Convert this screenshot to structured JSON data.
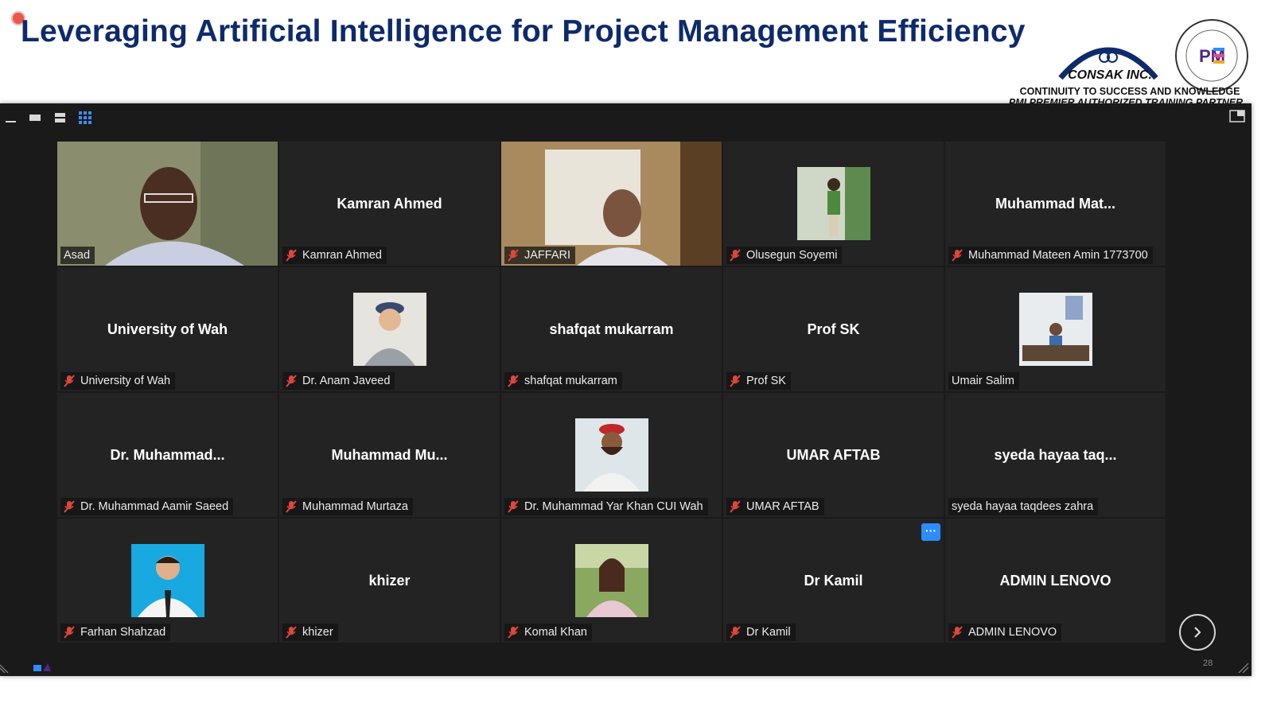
{
  "slide": {
    "title": "Leveraging Artificial Intelligence for Project Management Efficiency",
    "brand_name": "CONSAK INC.",
    "tagline": "CONTINUITY TO SUCCESS AND KNOWLEDGE",
    "tagline2": "PMI PREMIER AUTHORIZED TRAINING PARTNER",
    "pmi_seal_text": "PROJECT MANAGEMENT INSTITUTE · AUTHORIZED TRAINING PARTNER",
    "page_number": "28",
    "colors": {
      "title": "#0d2a6b",
      "accent": "#2d8cff",
      "active_speaker": "#c9e05a",
      "muted": "#e0463a"
    }
  },
  "toolbar": {
    "icons": [
      "minimize-icon",
      "speaker-view-icon",
      "stacked-view-icon",
      "gallery-view-icon",
      "exit-fullscreen-icon"
    ]
  },
  "participants": [
    {
      "label": "Asad",
      "muted": false,
      "video": "man-in-light-shirt"
    },
    {
      "label": "Kamran Ahmed",
      "center": "Kamran Ahmed",
      "muted": true
    },
    {
      "label": "JAFFARI",
      "muted": true,
      "video": "man-in-office"
    },
    {
      "label": "Olusegun Soyemi",
      "muted": true,
      "avatar": "man-outdoors"
    },
    {
      "label": "Muhammad Mateen Amin 1773700",
      "center": "Muhammad  Mat...",
      "muted": true
    },
    {
      "label": "University of Wah",
      "center": "University of Wah",
      "muted": true
    },
    {
      "label": "Dr. Anam Javeed",
      "muted": true,
      "avatar": "child-with-cap"
    },
    {
      "label": "shafqat mukarram",
      "center": "shafqat mukarram",
      "muted": true
    },
    {
      "label": "Prof SK",
      "center": "Prof SK",
      "muted": true
    },
    {
      "label": "Umair Salim",
      "muted": false,
      "avatar": "man-at-desk"
    },
    {
      "label": "Dr. Muhammad Aamir Saeed",
      "center": "Dr.  Muhammad...",
      "muted": true
    },
    {
      "label": "Muhammad Murtaza",
      "center": "Muhammad  Mu...",
      "muted": true
    },
    {
      "label": "Dr. Muhammad Yar Khan CUI Wah",
      "muted": true,
      "avatar": "man-with-red-cap"
    },
    {
      "label": "UMAR AFTAB",
      "center": "UMAR AFTAB",
      "muted": true
    },
    {
      "label": "syeda hayaa taqdees zahra",
      "center": "syeda hayaa taq...",
      "muted": false
    },
    {
      "label": "Farhan Shahzad",
      "muted": true,
      "avatar": "man-blue-background"
    },
    {
      "label": "khizer",
      "center": "khizer",
      "muted": true
    },
    {
      "label": "Komal Khan",
      "muted": true,
      "avatar": "woman-in-garden"
    },
    {
      "label": "Dr Kamil",
      "center": "Dr Kamil",
      "muted": true,
      "more": "···"
    },
    {
      "label": "ADMIN LENOVO",
      "center": "ADMIN LENOVO",
      "muted": true
    }
  ]
}
